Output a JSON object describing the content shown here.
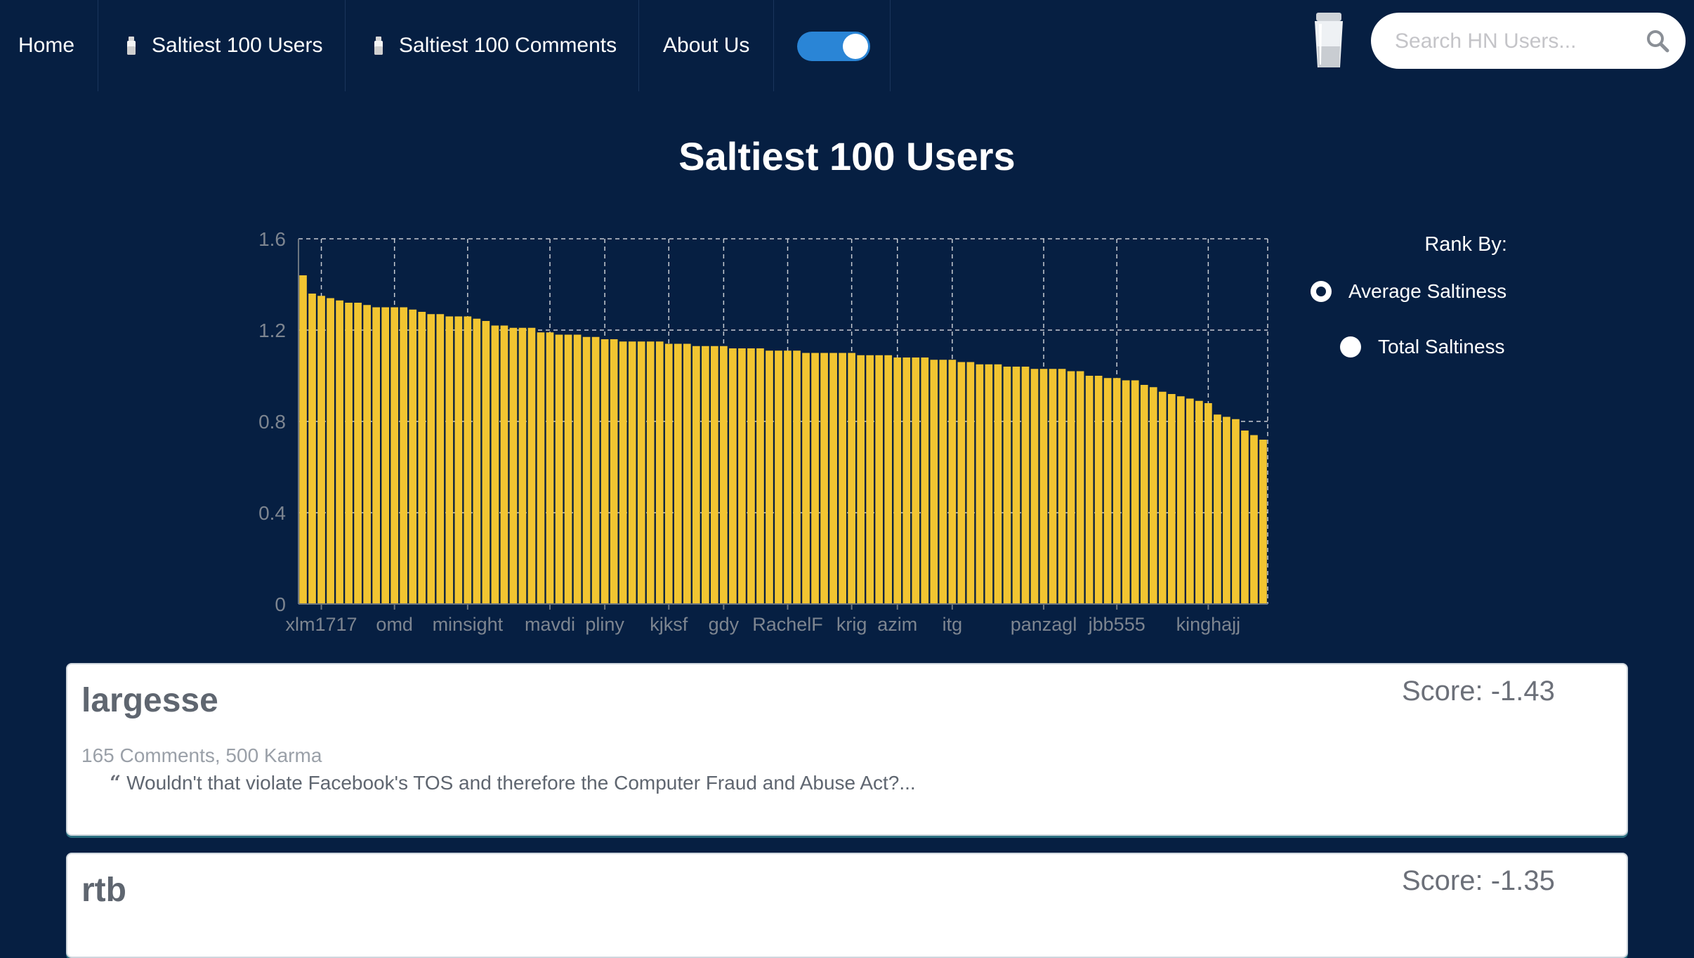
{
  "nav": {
    "home": "Home",
    "saltiest_users": "Saltiest 100 Users",
    "saltiest_comments": "Saltiest 100 Comments",
    "about": "About Us",
    "toggle_on": true,
    "search_placeholder": "Search HN Users...",
    "icons": [
      "salt-shaker-icon",
      "search-icon"
    ]
  },
  "page": {
    "title": "Saltiest 100 Users"
  },
  "chart_data": {
    "type": "bar",
    "title": "",
    "xlabel": "",
    "ylabel": "",
    "ylim": [
      0,
      1.6
    ],
    "y_ticks": [
      "0",
      "0.4",
      "0.8",
      "1.2",
      "1.6"
    ],
    "grid": true,
    "bar_color": "#f2c531",
    "tick_labels": [
      "xlm1717",
      "omd",
      "minsight",
      "mavdi",
      "pliny",
      "kjksf",
      "gdy",
      "RachelF",
      "krig",
      "azim",
      "itg",
      "panzagl",
      "jbb555",
      "kinghajj"
    ],
    "tick_label_bar_index": [
      2,
      10,
      18,
      27,
      33,
      40,
      46,
      53,
      60,
      65,
      71,
      81,
      89,
      99
    ],
    "values": [
      1.44,
      1.36,
      1.35,
      1.34,
      1.33,
      1.32,
      1.32,
      1.31,
      1.3,
      1.3,
      1.3,
      1.3,
      1.29,
      1.28,
      1.27,
      1.27,
      1.26,
      1.26,
      1.26,
      1.25,
      1.24,
      1.22,
      1.22,
      1.21,
      1.21,
      1.21,
      1.19,
      1.19,
      1.18,
      1.18,
      1.18,
      1.17,
      1.17,
      1.16,
      1.16,
      1.15,
      1.15,
      1.15,
      1.15,
      1.15,
      1.14,
      1.14,
      1.14,
      1.13,
      1.13,
      1.13,
      1.13,
      1.12,
      1.12,
      1.12,
      1.12,
      1.11,
      1.11,
      1.11,
      1.11,
      1.1,
      1.1,
      1.1,
      1.1,
      1.1,
      1.1,
      1.09,
      1.09,
      1.09,
      1.09,
      1.08,
      1.08,
      1.08,
      1.08,
      1.07,
      1.07,
      1.07,
      1.06,
      1.06,
      1.05,
      1.05,
      1.05,
      1.04,
      1.04,
      1.04,
      1.03,
      1.03,
      1.03,
      1.03,
      1.02,
      1.02,
      1.0,
      1.0,
      0.99,
      0.99,
      0.98,
      0.98,
      0.96,
      0.95,
      0.93,
      0.92,
      0.91,
      0.9,
      0.89,
      0.88,
      0.83,
      0.82,
      0.81,
      0.76,
      0.74,
      0.72
    ]
  },
  "rank": {
    "label": "Rank By:",
    "options": [
      {
        "label": "Average Saltiness",
        "checked": true
      },
      {
        "label": "Total Saltiness",
        "checked": false
      }
    ]
  },
  "cards": [
    {
      "username": "largesse",
      "score": "Score: -1.43",
      "meta": "165 Comments, 500 Karma",
      "quote": "Wouldn't that violate Facebook's TOS and therefore the Computer Fraud and Abuse Act?..."
    },
    {
      "username": "rtb",
      "score": "Score: -1.35"
    }
  ]
}
